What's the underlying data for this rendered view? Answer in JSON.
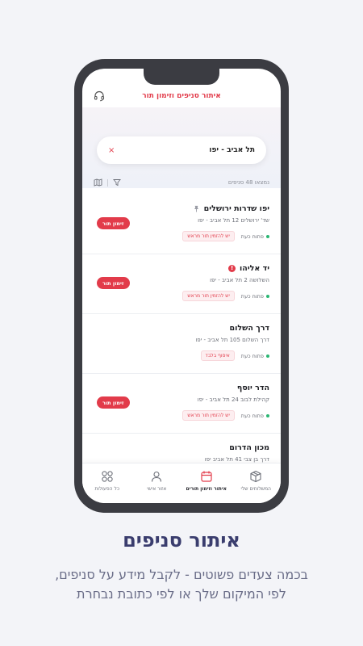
{
  "app": {
    "title": "איתור סניפים וזימון תור"
  },
  "search": {
    "value": "תל אביב - יפו",
    "clear_icon": "×"
  },
  "results": {
    "count_text": "נמצאו 48 סניפים"
  },
  "branches": [
    {
      "name": "יפו שדרות ירושלים",
      "address": "שד' ירושלים 12 תל אביב - יפו",
      "status": "פתוח כעת",
      "tag": "יש להזמין תור מראש",
      "button": "זימון תור",
      "icon": "pin-icon"
    },
    {
      "name": "יד אליהו",
      "address": "השלושה 2 תל אביב - יפו",
      "status": "פתוח כעת",
      "tag": "יש להזמין תור מראש",
      "button": "זימון תור",
      "icon": "alert-icon",
      "alert_symbol": "!"
    },
    {
      "name": "דרך השלום",
      "address": "דרך השלום 105 תל אביב - יפו",
      "status": "פתוח כעת",
      "tag": "איסוף בלבד"
    },
    {
      "name": "הדר יוסף",
      "address": "קהילת לבוב 24 תל אביב - יפו",
      "status": "פתוח כעת",
      "tag": "יש להזמין תור מראש",
      "button": "זימון תור"
    },
    {
      "name": "מכון הדרום",
      "address": "דרך בן צבי 41 תל אביב יפו"
    }
  ],
  "tabs": [
    {
      "label": "המשלוחים שלי",
      "icon": "package-icon"
    },
    {
      "label": "איתור וזימון תורים",
      "icon": "calendar-icon",
      "active": true
    },
    {
      "label": "אזור אישי",
      "icon": "user-icon"
    },
    {
      "label": "כל הפעולות",
      "icon": "grid-icon"
    }
  ],
  "promo": {
    "headline": "איתור סניפים",
    "line1": "בכמה צעדים פשוטים - לקבל מידע על סניפים,",
    "line2": "לפי המיקום שלך או לפי כתובת נבחרת"
  },
  "colors": {
    "accent": "#e23b4a",
    "open_status": "#2bb673",
    "phone_frame": "#3b3c42",
    "headline": "#3a3d6e"
  }
}
